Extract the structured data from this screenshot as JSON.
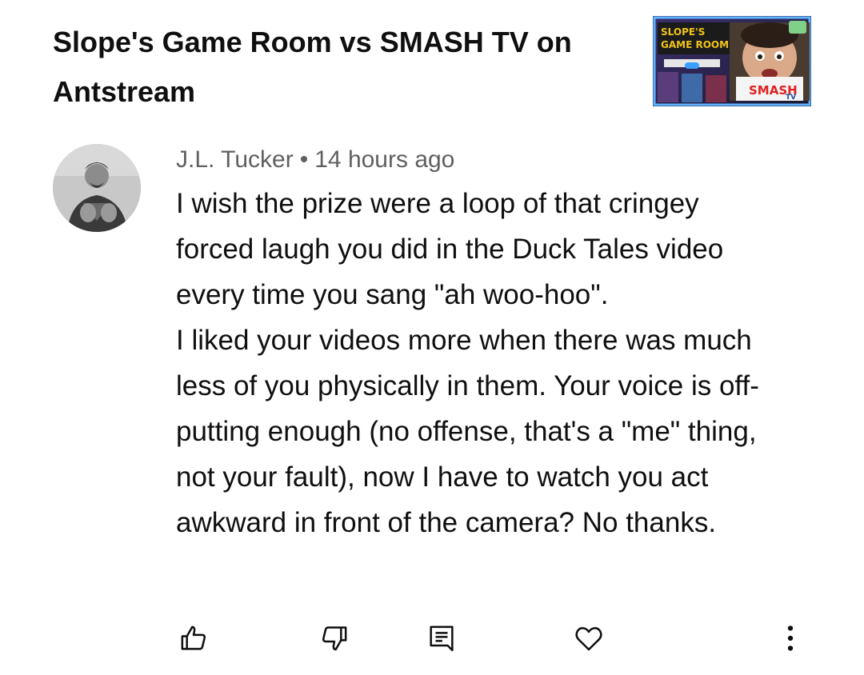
{
  "video": {
    "title": "Slope's Game Room vs SMASH TV on Antstream",
    "thumbnail": {
      "logo_line1": "SLOPE'S",
      "logo_line2": "GAME ROOM",
      "game_logo": "SMASH",
      "game_logo_sub": "TV"
    }
  },
  "comment": {
    "author": "J.L. Tucker",
    "separator": "•",
    "time": "14 hours ago",
    "paragraphs": [
      "I wish the prize were a loop of that cringey forced laugh you did in the Duck Tales video every time you sang \"ah woo-hoo\".",
      "I liked your videos more when there was much less of you physically in them. Your voice is off-putting enough (no offense, that's a \"me\" thing, not your fault), now I have to watch you act awkward in front of the camera? No thanks."
    ]
  },
  "actions": {
    "like_icon": "thumbs-up-icon",
    "dislike_icon": "thumbs-down-icon",
    "reply_icon": "comment-reply-icon",
    "heart_icon": "heart-icon",
    "more_icon": "more-vertical-icon"
  },
  "colors": {
    "text_primary": "#0f0f0f",
    "text_secondary": "#606060",
    "background": "#ffffff"
  }
}
